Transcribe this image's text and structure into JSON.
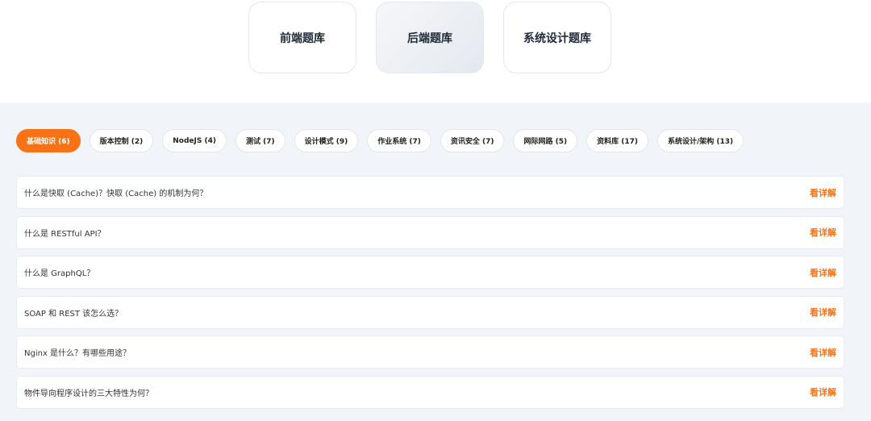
{
  "categories": [
    {
      "label": "前端题库",
      "active": false
    },
    {
      "label": "后端题库",
      "active": true
    },
    {
      "label": "系统设计题库",
      "active": false
    }
  ],
  "tags": [
    {
      "label": "基础知识 (6)",
      "active": true
    },
    {
      "label": "版本控制 (2)",
      "active": false
    },
    {
      "label": "NodeJS (4)",
      "active": false
    },
    {
      "label": "测试 (7)",
      "active": false
    },
    {
      "label": "设计模式 (9)",
      "active": false
    },
    {
      "label": "作业系统 (7)",
      "active": false
    },
    {
      "label": "资讯安全 (7)",
      "active": false
    },
    {
      "label": "网际网路 (5)",
      "active": false
    },
    {
      "label": "资料库 (17)",
      "active": false
    },
    {
      "label": "系统设计/架构 (13)",
      "active": false
    }
  ],
  "questions": [
    {
      "text": "什么是快取 (Cache)？快取 (Cache) 的机制为何？",
      "link": "看详解"
    },
    {
      "text": "什么是 RESTful API？",
      "link": "看详解"
    },
    {
      "text": "什么是 GraphQL？",
      "link": "看详解"
    },
    {
      "text": "SOAP 和 REST 该怎么选？",
      "link": "看详解"
    },
    {
      "text": "Nginx 是什么？有哪些用途？",
      "link": "看详解"
    },
    {
      "text": "物件导向程序设计的三大特性为何？",
      "link": "看详解"
    }
  ],
  "colors": {
    "accent": "#f97316",
    "background": "#f1f4f8"
  }
}
